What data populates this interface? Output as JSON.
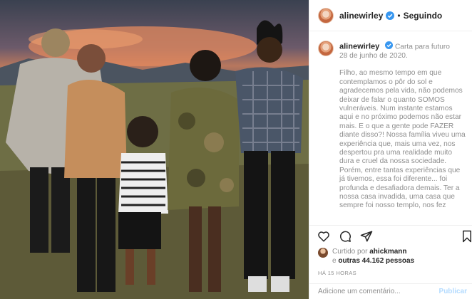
{
  "post": {
    "username": "alinewirley",
    "follow_separator": "•",
    "follow_status": "Seguindo"
  },
  "caption": {
    "username": "alinewirley",
    "title": "Carta para futuro",
    "date": "28 de junho de 2020.",
    "text": "Filho, ao mesmo tempo em que\ncontemplamos o pôr do sol e\nagradecemos pela vida, não podemos\ndeixar de falar o quanto SOMOS\nvulneráveis. Num instante estamos\naqui e no próximo podemos não estar\nmais. E o que a gente pode FAZER\ndiante disso?! Nossa família viveu uma\nexperiência que, mais uma vez, nos\ndespertou pra uma realidade muito\ndura e cruel da nossa sociedade.\nPorém, entre tantas experiências que\njá tivemos, essa foi diferente... foi\nprofunda e desafiadora demais. Ter a\nnossa casa invadida, uma casa que\nsempre foi nosso templo, nos fez"
  },
  "likes": {
    "prefix": "Curtido por",
    "liker": "ahickmann",
    "conjunction": "e",
    "others": "outras 44.162 pessoas"
  },
  "timestamp": "HÁ 15 HORAS",
  "comment": {
    "placeholder": "Adicione um comentário...",
    "publish_label": "Publicar"
  },
  "icons": {
    "verified": "verified-badge-icon",
    "like": "heart-icon",
    "comment": "comment-bubble-icon",
    "share": "paper-plane-icon",
    "save": "bookmark-icon"
  },
  "colors": {
    "verified": "#3897f0",
    "muted_text": "#8e8e8e",
    "publish_disabled": "#b3dbff"
  }
}
